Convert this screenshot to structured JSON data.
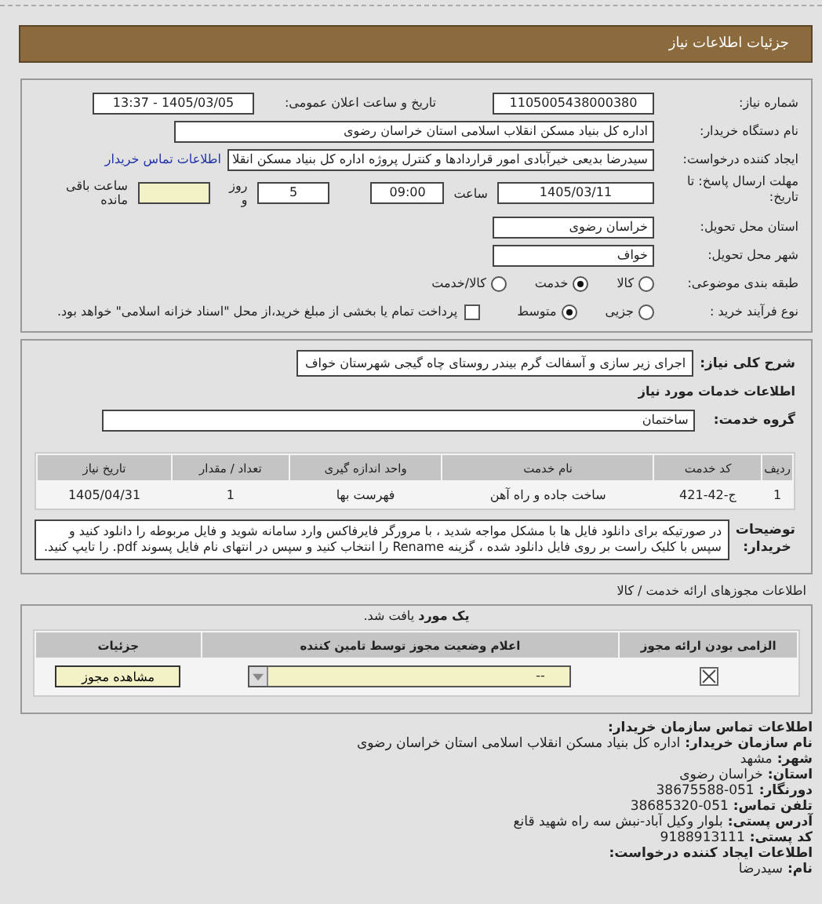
{
  "header": {
    "title": "جزئیات اطلاعات نیاز"
  },
  "need": {
    "label": "شماره نیاز:",
    "value": "1105005438000380"
  },
  "announce": {
    "label": "تاریخ و ساعت اعلان عمومی:",
    "value": "1405/03/05 - 13:37"
  },
  "buyer": {
    "label": "نام دستگاه خریدار:",
    "value": "اداره کل بنیاد مسکن انقلاب اسلامی استان خراسان رضوی"
  },
  "creator": {
    "label": "ایجاد کننده درخواست:",
    "value": "سیدرضا بدیعی خیرآبادی امور قراردادها و کنترل پروژه اداره کل بنیاد مسکن انقلا",
    "link": "اطلاعات تماس خریدار"
  },
  "deadline": {
    "label": "مهلت ارسال پاسخ: تا تاریخ:",
    "date": "1405/03/11",
    "time_label": "ساعت",
    "time": "09:00",
    "days": "5",
    "days_label": "روز و",
    "remaining_label": "ساعت باقی مانده"
  },
  "province": {
    "label": "استان محل تحویل:",
    "value": "خراسان رضوی"
  },
  "city": {
    "label": "شهر محل تحویل:",
    "value": "خواف"
  },
  "category": {
    "label": "طبقه بندی موضوعی:",
    "options": [
      {
        "label": "کالا",
        "selected": false
      },
      {
        "label": "خدمت",
        "selected": true
      },
      {
        "label": "کالا/خدمت",
        "selected": false
      }
    ]
  },
  "process": {
    "label": "نوع فرآیند خرید :",
    "options": [
      {
        "label": "جزیی",
        "selected": false
      },
      {
        "label": "متوسط",
        "selected": true
      }
    ],
    "treasury": {
      "checked": false,
      "label": "پرداخت تمام یا بخشی از مبلغ خرید،از محل \"اسناد خزانه اسلامی\" خواهد بود."
    }
  },
  "summary": {
    "label": "شرح کلی نیاز:",
    "value": "اجرای زیر سازی و آسفالت گرم بیندر روستای چاه گیجی شهرستان خواف"
  },
  "services_title": "اطلاعات خدمات مورد نیاز",
  "service_group": {
    "label": "گروه خدمت:",
    "value": "ساختمان"
  },
  "services_table": {
    "columns": [
      "ردیف",
      "کد خدمت",
      "نام خدمت",
      "واحد اندازه گیری",
      "تعداد / مقدار",
      "تاریخ نیاز"
    ],
    "rows": [
      [
        "1",
        "ج-42-421",
        "ساخت جاده و راه آهن",
        "فهرست بها",
        "1",
        "1405/04/31"
      ]
    ]
  },
  "notes": {
    "label": "توضیحات خریدار:",
    "text": "در صورتیکه برای دانلود فایل ها با مشکل مواجه شدید ، با مرورگر فایرفاکس وارد سامانه شوید و فایل مربوطه را دانلود کنید و سپس با کلیک راست بر روی فایل دانلود شده ، گزینه Rename را انتخاب کنید و سپس در انتهای نام فایل پسوند pdf. را تایپ کنید."
  },
  "permits_title": "اطلاعات مجوزهای ارائه خدمت / کالا",
  "permits": {
    "found": "**یک مورد** یافت شد.",
    "columns": [
      "الزامی بودن ارائه مجوز",
      "اعلام وضعیت مجوز توسط تامین کننده",
      "جزئیات"
    ],
    "rows": [
      {
        "required": true,
        "status": "--",
        "button": "مشاهده مجوز"
      }
    ]
  },
  "contact": {
    "title": "اطلاعات تماس سازمان خریدار:",
    "lines": [
      {
        "label": "نام سازمان خریدار:",
        "value": "اداره کل بنیاد مسکن انقلاب اسلامی استان خراسان رضوی"
      },
      {
        "label": "شهر:",
        "value": "مشهد"
      },
      {
        "label": "استان:",
        "value": "خراسان رضوی"
      },
      {
        "label": "دورنگار:",
        "value": "38675588-051"
      },
      {
        "label": "تلفن تماس:",
        "value": "38685320-051"
      },
      {
        "label": "آدرس پستی:",
        "value": "بلوار وکیل آباد-نبش سه راه شهید قانع"
      },
      {
        "label": "کد پستی:",
        "value": "9188913111"
      }
    ],
    "creator_title": "اطلاعات ایجاد کننده درخواست:",
    "creator_lines": [
      {
        "label": "نام:",
        "value": "سیدرضا"
      }
    ]
  }
}
